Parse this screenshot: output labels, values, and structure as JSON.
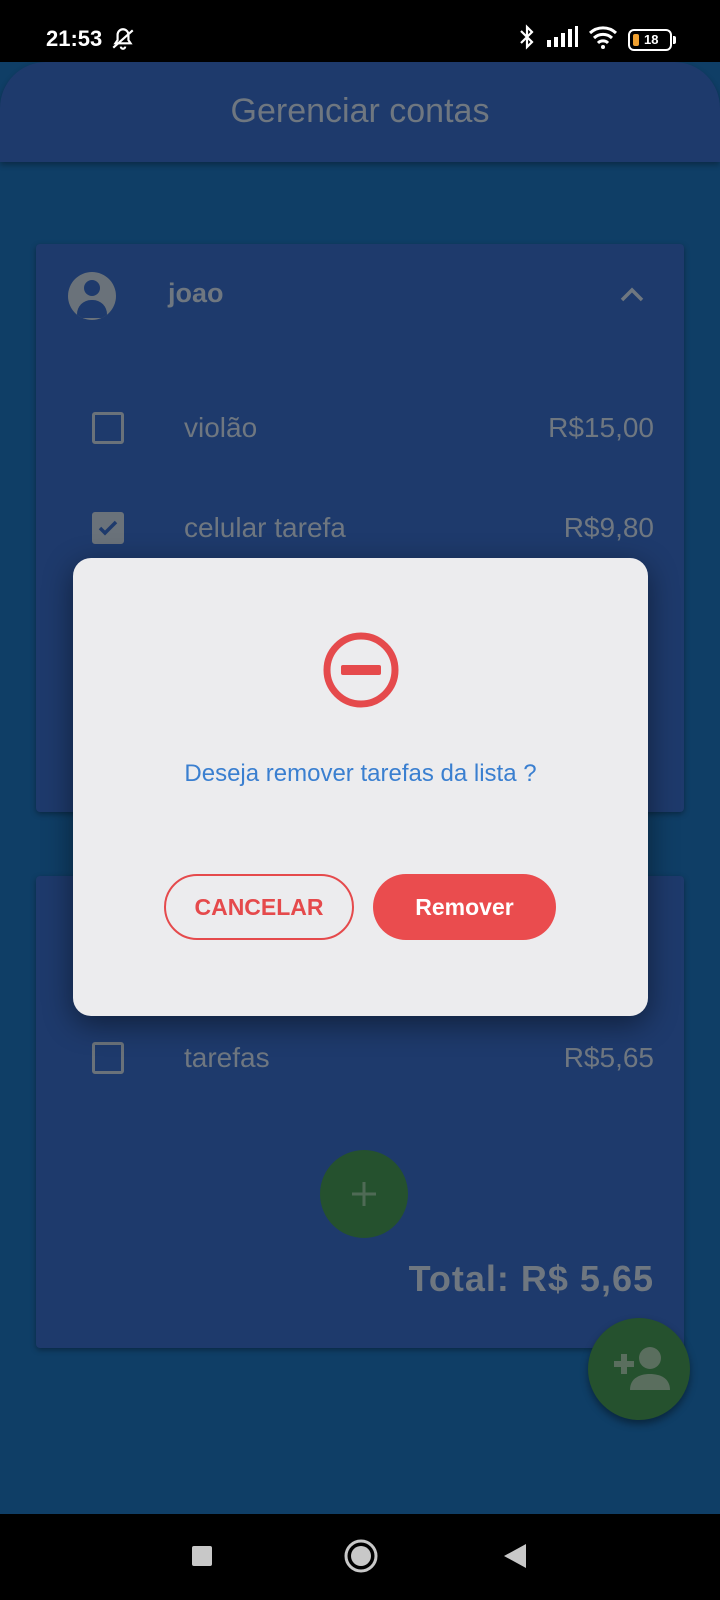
{
  "status_bar": {
    "time": "21:53",
    "battery": "18",
    "icons": [
      "bell-off-icon",
      "bluetooth-icon",
      "signal-icon",
      "wifi-icon",
      "battery-icon"
    ]
  },
  "app_bar": {
    "title": "Gerenciar contas"
  },
  "accounts": [
    {
      "name": "joao",
      "expanded": true,
      "items": [
        {
          "label": "violão",
          "price": "R$15,00",
          "checked": false
        },
        {
          "label": "celular tarefa",
          "price": "R$9,80",
          "checked": true
        }
      ]
    },
    {
      "items": [
        {
          "label": "tarefas",
          "price": "R$5,65",
          "checked": false
        }
      ],
      "total": "Total: R$ 5,65"
    }
  ],
  "dialog": {
    "icon": "remove-circle-icon",
    "message": "Deseja remover tarefas da lista ?",
    "cancel_label": "CANCELAR",
    "remove_label": "Remover"
  },
  "colors": {
    "accent_red": "#ea4c4e",
    "message_blue": "#3a7fd0",
    "app_bar": "#1e3a6c",
    "fab_green": "#25512e"
  },
  "nav_bar": {
    "buttons": [
      "recents-icon",
      "home-icon",
      "back-icon"
    ]
  }
}
